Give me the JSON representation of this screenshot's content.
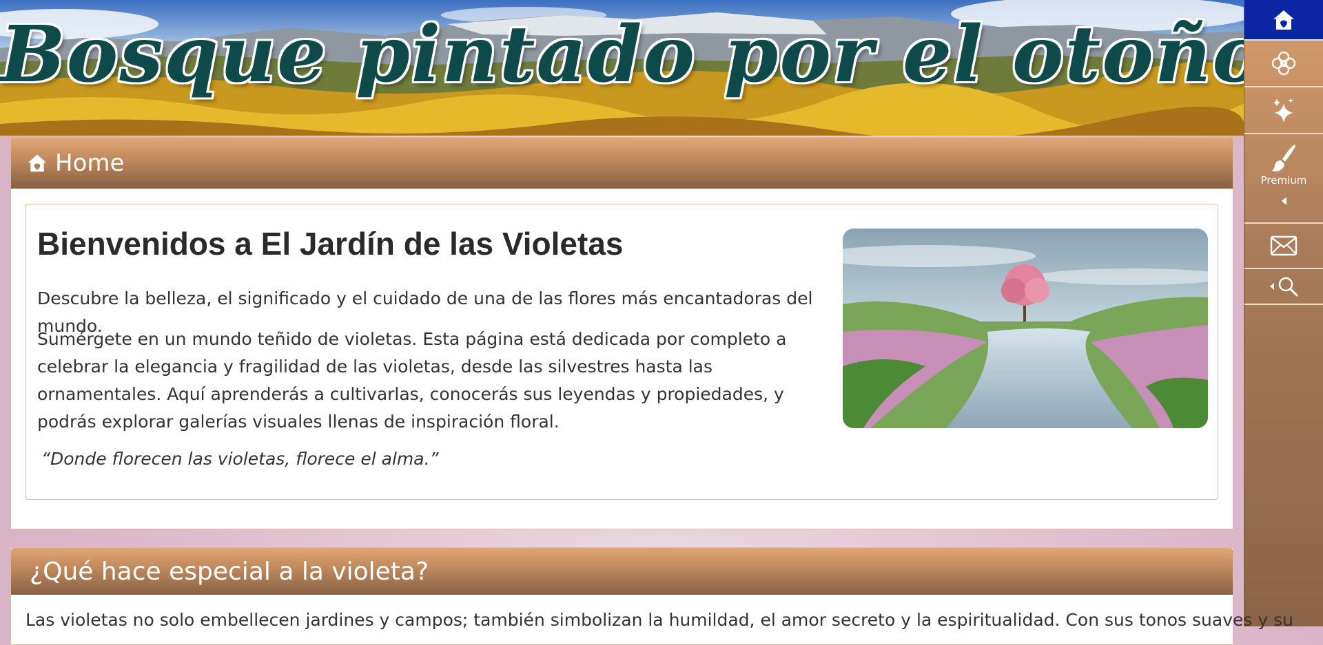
{
  "banner": {
    "title": "Bosque pintado por el otoño"
  },
  "rail": {
    "items": [
      {
        "icon": "home-icon"
      },
      {
        "icon": "flower-icon"
      },
      {
        "icon": "sparkles-icon"
      },
      {
        "icon": "brush-icon",
        "label": "Premium"
      },
      {
        "icon": "mail-icon"
      },
      {
        "icon": "search-icon"
      }
    ]
  },
  "home": {
    "header": "Home",
    "title": "Bienvenidos a El Jardín de las Violetas",
    "intro": "Descubre la belleza, el significado y el cuidado de una de las flores más encantadoras del mundo.",
    "body": "Sumérgete en un mundo teñido de violetas. Esta página está dedicada por completo a celebrar la elegancia y fragilidad de las violetas, desde las silvestres hasta las ornamentales. Aquí aprenderás a cultivarlas, conocerás sus leyendas y propiedades, y podrás explorar galerías visuales llenas de inspiración floral.",
    "quote": "“Donde florecen las violetas, florece el alma.”"
  },
  "special": {
    "header": "¿Qué hace especial a la violeta?",
    "text": "Las violetas no solo embellecen jardines y campos; también simbolizan la humildad, el amor secreto y la espiritualidad. Con sus tonos suaves y su"
  }
}
